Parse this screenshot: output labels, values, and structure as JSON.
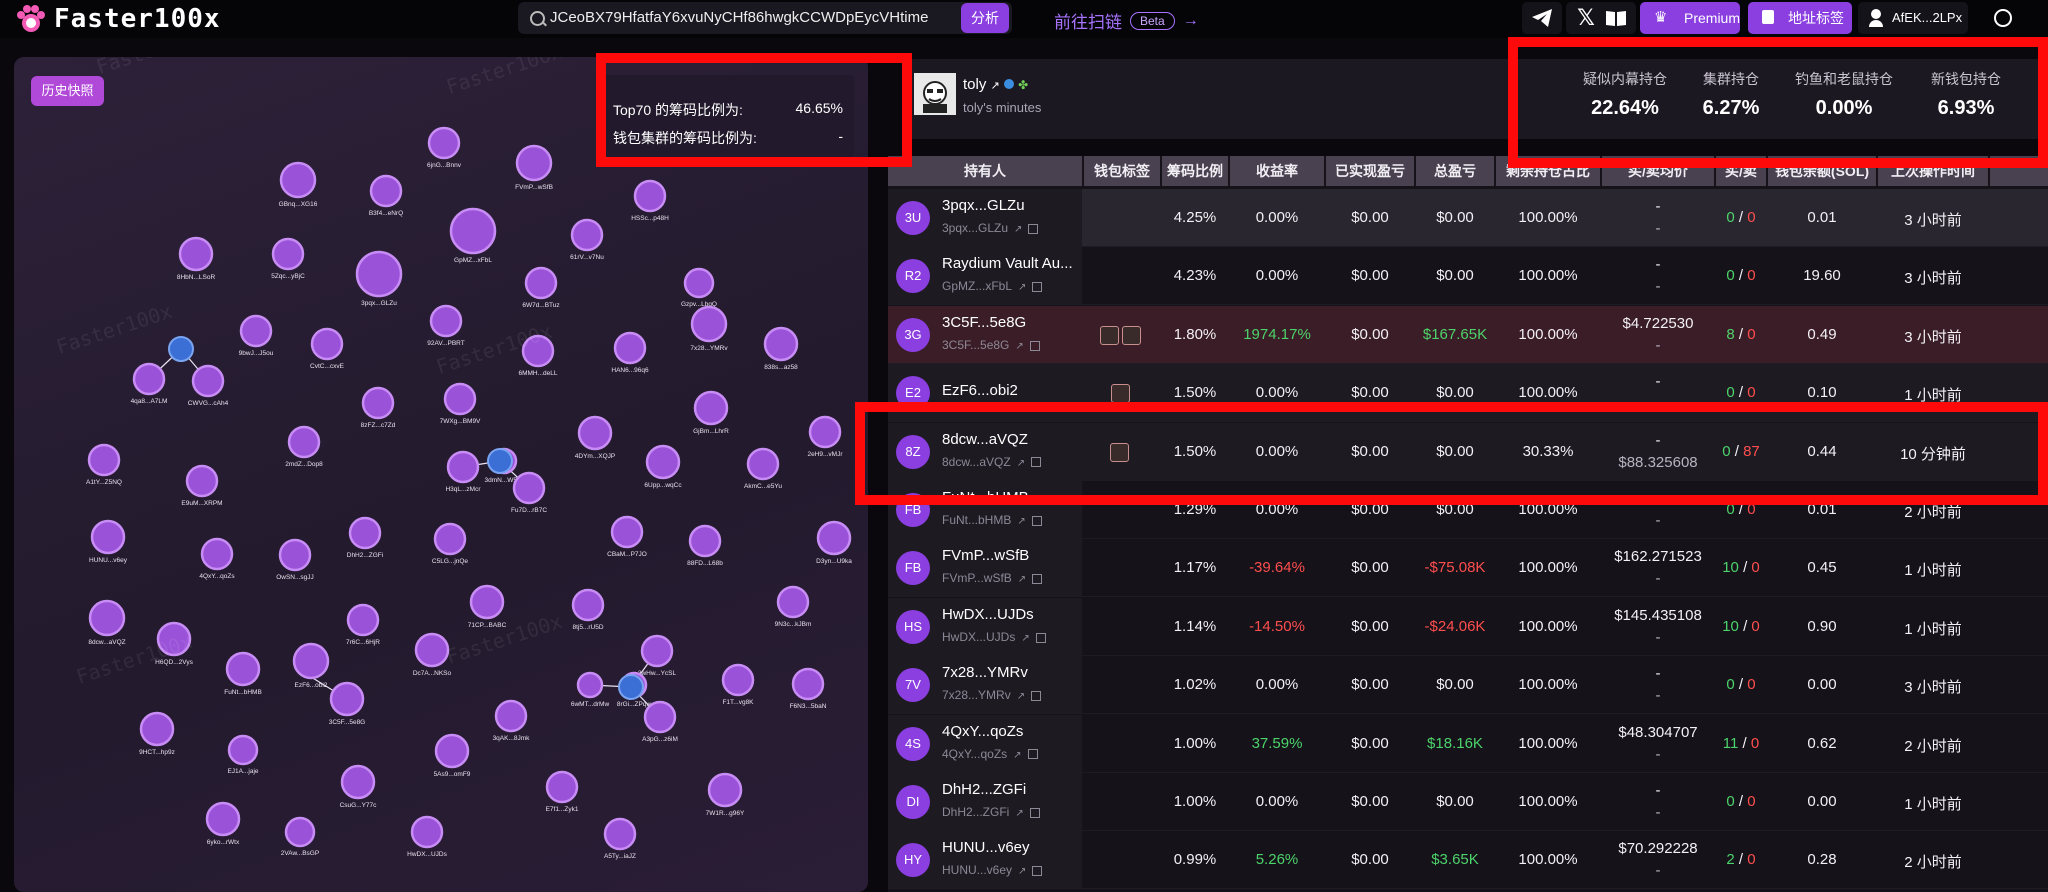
{
  "topbar": {
    "logo": "Faster100x",
    "search_value": "JCeoBX79HfatfaY6xvuNyCHf86hwgkCCWDpEycVHtime",
    "analyze_label": "分析",
    "scan_label": "前往扫链",
    "beta_label": "Beta",
    "premium_label": "Premium",
    "address_tag_label": "地址标签",
    "wallet_label": "AfEK...2LPx"
  },
  "left": {
    "history_label": "历史快照",
    "top70_label": "Top70 的筹码比例为:",
    "top70_value": "46.65%",
    "cluster_label": "钱包集群的筹码比例为:",
    "cluster_value": "-",
    "watermark": "Faster100x",
    "nodes": [
      {
        "label": "6jnG...Bnnv"
      },
      {
        "label": "FVmP...wSfB"
      },
      {
        "label": "GBnq...XG16"
      },
      {
        "label": "B3f4...eNrQ"
      },
      {
        "label": "HSSc...p48H"
      },
      {
        "label": "GpMZ...xFbL"
      },
      {
        "label": "61rV...v7Nu"
      },
      {
        "label": "8HbN...LSoR"
      },
      {
        "label": "5Zqc...yBjC"
      },
      {
        "label": "3pqx...GLZu"
      },
      {
        "label": "6W7d...BTuz"
      },
      {
        "label": "Gzpv...LbgQ"
      },
      {
        "label": "9bwJ...J5ou"
      },
      {
        "label": "92AV...PBRT"
      },
      {
        "label": "7x28...YMRv"
      },
      {
        "label": "CvtC...cxvE"
      },
      {
        "label": "6MMH...deLL"
      },
      {
        "label": "HAN6...96q6"
      },
      {
        "label": "838s...az58"
      },
      {
        "label": "4qa8...A7LM"
      },
      {
        "label": "CWVG...cAh4"
      },
      {
        "label": "8zFZ...c7Zd"
      },
      {
        "label": "7WXg...BM9V"
      },
      {
        "label": "GjBm...LhrR"
      },
      {
        "label": "2mdZ...Dop8"
      },
      {
        "label": "4DYm...XQJP"
      },
      {
        "label": "2eH9...vMJr"
      },
      {
        "label": "A1tY...Z5NQ"
      },
      {
        "label": "H3qL...zMcr"
      },
      {
        "label": "3dmN...W5Hf"
      },
      {
        "label": "E9uM...XRPM"
      },
      {
        "label": "6Upp...wqCc"
      },
      {
        "label": "AkmC...e5Yu"
      },
      {
        "label": "Fu7D...rB7C"
      },
      {
        "label": "HUNU...v6ey"
      },
      {
        "label": "4QxY...qoZs"
      },
      {
        "label": "OwSN...sgJJ"
      },
      {
        "label": "DhH2...ZGFi"
      },
      {
        "label": "C5LG...jnQe"
      },
      {
        "label": "CBaM...P7JO"
      },
      {
        "label": "88FD...L68b"
      },
      {
        "label": "D3yn...U9ka"
      },
      {
        "label": "8dcw...aVQZ"
      },
      {
        "label": "H6QD...2Vys"
      },
      {
        "label": "7r6C...6HjR"
      },
      {
        "label": "71CP...BABC"
      },
      {
        "label": "8tj5...rU5D"
      },
      {
        "label": "9N3c...kJBm"
      },
      {
        "label": "FuNt...bHMB"
      },
      {
        "label": "EzF6...obi2"
      },
      {
        "label": "Dc7A...NKSo"
      },
      {
        "label": "3wHw...YcSL"
      },
      {
        "label": "F1T...vg8K"
      },
      {
        "label": "6wMT...drMw"
      },
      {
        "label": "8rGi...ZPqw"
      },
      {
        "label": "F6N3...5baN"
      },
      {
        "label": "3C5F...5e8G"
      },
      {
        "label": "9HCT...hp9z"
      },
      {
        "label": "3qAK...8Jmk"
      },
      {
        "label": "A3pG...z6iM"
      },
      {
        "label": "EJ1A...jaje"
      },
      {
        "label": "5As9...omF9"
      },
      {
        "label": "CsuG...Y77c"
      },
      {
        "label": "E7f1...Zyk1"
      },
      {
        "label": "7W1R...g96Y"
      },
      {
        "label": "6yko...rWtx"
      },
      {
        "label": "2VAw...BsGP"
      },
      {
        "label": "HwDX...UJDs"
      },
      {
        "label": "A5Ty...iaJZ"
      }
    ]
  },
  "token": {
    "name": "toly",
    "subtitle": "toly's minutes",
    "stats": [
      {
        "label": "疑似内幕持仓",
        "value": "22.64%"
      },
      {
        "label": "集群持仓",
        "value": "6.27%"
      },
      {
        "label": "钓鱼和老鼠持仓",
        "value": "0.00%"
      },
      {
        "label": "新钱包持仓",
        "value": "6.93%"
      }
    ]
  },
  "table": {
    "headers": [
      "持有人",
      "钱包标签",
      "筹码比例",
      "收益率",
      "已实现盈亏",
      "总盈亏",
      "剩余持仓占比",
      "买/卖均价",
      "买/卖",
      "钱包余额(SOL)",
      "上次操作时间"
    ],
    "rows": [
      {
        "av": "3U",
        "name": "3pqx...GLZu",
        "addr": "3pqx...GLZu",
        "ratio": "4.25%",
        "roi": "0.00%",
        "realized": "$0.00",
        "total": "$0.00",
        "remain": "100.00%",
        "price1": "-",
        "price2": "-",
        "buys": "0",
        "sells": "0",
        "bal": "0.01",
        "time": "3 小时前"
      },
      {
        "av": "R2",
        "name": "Raydium Vault Au...",
        "addr": "GpMZ...xFbL",
        "ratio": "4.23%",
        "roi": "0.00%",
        "realized": "$0.00",
        "total": "$0.00",
        "remain": "100.00%",
        "price1": "-",
        "price2": "-",
        "buys": "0",
        "sells": "0",
        "bal": "19.60",
        "time": "3 小时前"
      },
      {
        "av": "3G",
        "name": "3C5F...5e8G",
        "addr": "3C5F...5e8G",
        "ratio": "1.80%",
        "roi": "1974.17%",
        "realized": "$0.00",
        "total": "$167.65K",
        "remain": "100.00%",
        "price1": "$4.722530",
        "price2": "-",
        "buys": "8",
        "sells": "0",
        "bal": "0.49",
        "time": "3 小时前"
      },
      {
        "av": "E2",
        "name": "EzF6...obi2",
        "addr": "",
        "ratio": "1.50%",
        "roi": "0.00%",
        "realized": "$0.00",
        "total": "$0.00",
        "remain": "100.00%",
        "price1": "-",
        "price2": "",
        "buys": "0",
        "sells": "0",
        "bal": "0.10",
        "time": "1 小时前"
      },
      {
        "av": "8Z",
        "name": "8dcw...aVQZ",
        "addr": "8dcw...aVQZ",
        "ratio": "1.50%",
        "roi": "0.00%",
        "realized": "$0.00",
        "total": "$0.00",
        "remain": "30.33%",
        "price1": "-",
        "price2": "$88.325608",
        "buys": "0",
        "sells": "87",
        "bal": "0.44",
        "time": "10 分钟前"
      },
      {
        "av": "FB",
        "name": "FuNt...bHMB",
        "addr": "FuNt...bHMB",
        "ratio": "1.29%",
        "roi": "0.00%",
        "realized": "$0.00",
        "total": "$0.00",
        "remain": "100.00%",
        "price1": "",
        "price2": "-",
        "buys": "0",
        "sells": "0",
        "bal": "0.01",
        "time": "2 小时前"
      },
      {
        "av": "FB",
        "name": "FVmP...wSfB",
        "addr": "FVmP...wSfB",
        "ratio": "1.17%",
        "roi": "-39.64%",
        "realized": "$0.00",
        "total": "-$75.08K",
        "remain": "100.00%",
        "price1": "$162.271523",
        "price2": "-",
        "buys": "10",
        "sells": "0",
        "bal": "0.45",
        "time": "1 小时前"
      },
      {
        "av": "HS",
        "name": "HwDX...UJDs",
        "addr": "HwDX...UJDs",
        "ratio": "1.14%",
        "roi": "-14.50%",
        "realized": "$0.00",
        "total": "-$24.06K",
        "remain": "100.00%",
        "price1": "$145.435108",
        "price2": "-",
        "buys": "10",
        "sells": "0",
        "bal": "0.90",
        "time": "1 小时前"
      },
      {
        "av": "7V",
        "name": "7x28...YMRv",
        "addr": "7x28...YMRv",
        "ratio": "1.02%",
        "roi": "0.00%",
        "realized": "$0.00",
        "total": "$0.00",
        "remain": "100.00%",
        "price1": "-",
        "price2": "-",
        "buys": "0",
        "sells": "0",
        "bal": "0.00",
        "time": "3 小时前"
      },
      {
        "av": "4S",
        "name": "4QxY...qoZs",
        "addr": "4QxY...qoZs",
        "ratio": "1.00%",
        "roi": "37.59%",
        "realized": "$0.00",
        "total": "$18.16K",
        "remain": "100.00%",
        "price1": "$48.304707",
        "price2": "-",
        "buys": "11",
        "sells": "0",
        "bal": "0.62",
        "time": "2 小时前"
      },
      {
        "av": "DI",
        "name": "DhH2...ZGFi",
        "addr": "DhH2...ZGFi",
        "ratio": "1.00%",
        "roi": "0.00%",
        "realized": "$0.00",
        "total": "$0.00",
        "remain": "100.00%",
        "price1": "-",
        "price2": "-",
        "buys": "0",
        "sells": "0",
        "bal": "0.00",
        "time": "1 小时前"
      },
      {
        "av": "HY",
        "name": "HUNU...v6ey",
        "addr": "HUNU...v6ey",
        "ratio": "0.99%",
        "roi": "5.26%",
        "realized": "$0.00",
        "total": "$3.65K",
        "remain": "100.00%",
        "price1": "$70.292228",
        "price2": "-",
        "buys": "2",
        "sells": "0",
        "bal": "0.28",
        "time": "2 小时前"
      }
    ],
    "extra": [
      "1",
      "1",
      "1",
      "红"
    ]
  }
}
